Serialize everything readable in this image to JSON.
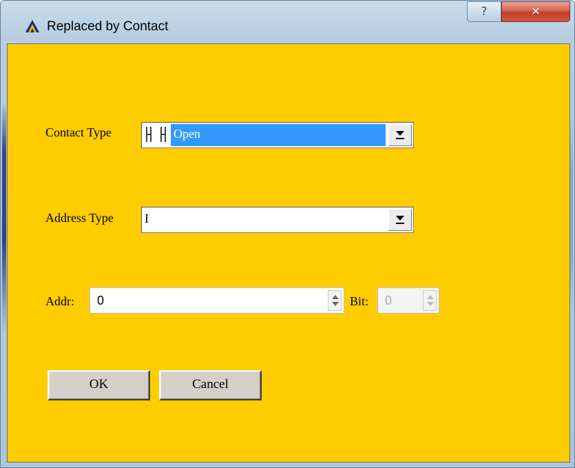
{
  "window": {
    "title": "Replaced by Contact",
    "help_label": "?",
    "close_label": "✕"
  },
  "form": {
    "contact_type": {
      "label": "Contact Type",
      "selected_value": "Open"
    },
    "address_type": {
      "label": "Address Type",
      "selected_value": "I"
    },
    "addr": {
      "label": "Addr:",
      "value": "0"
    },
    "bit": {
      "label": "Bit:",
      "value": "0",
      "disabled": true
    }
  },
  "buttons": {
    "ok_label": "OK",
    "cancel_label": "Cancel"
  },
  "colors": {
    "client_background": "#ffcc00",
    "selection_highlight": "#3399ff",
    "button_face": "#d4d0c8",
    "close_button": "#c23d27"
  }
}
